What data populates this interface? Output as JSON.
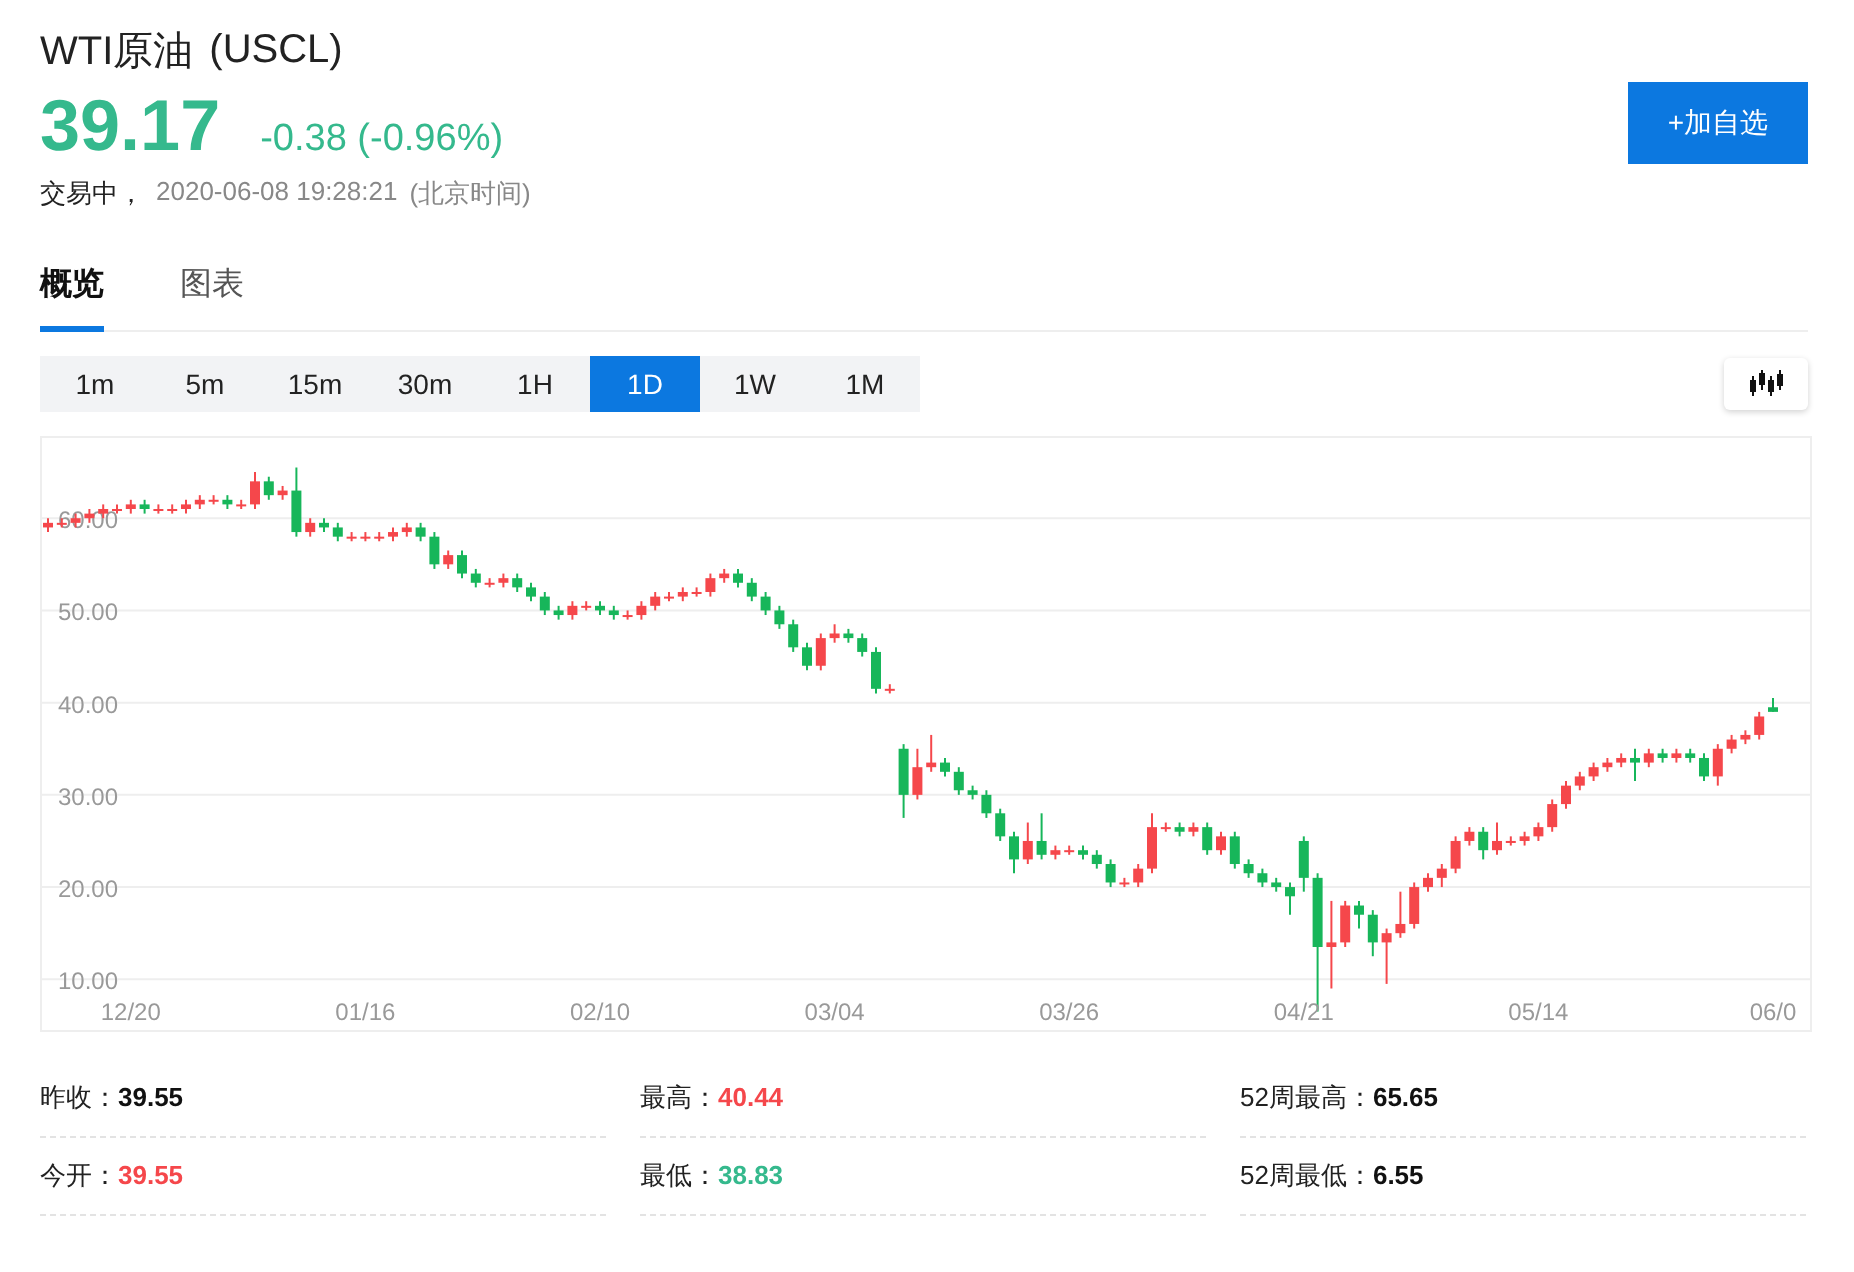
{
  "header": {
    "title": "WTI原油",
    "code": "(USCL)",
    "price": "39.17",
    "change": "-0.38 (-0.96%)",
    "color": "#35b98d",
    "status": "交易中，",
    "timestamp": "2020-06-08 19:28:21",
    "timezone": "(北京时间)",
    "watch_button": "+加自选"
  },
  "tabs": [
    {
      "label": "概览",
      "selected": true
    },
    {
      "label": "图表",
      "selected": false
    }
  ],
  "periods": [
    {
      "label": "1m",
      "selected": false
    },
    {
      "label": "5m",
      "selected": false
    },
    {
      "label": "15m",
      "selected": false
    },
    {
      "label": "30m",
      "selected": false
    },
    {
      "label": "1H",
      "selected": false
    },
    {
      "label": "1D",
      "selected": true
    },
    {
      "label": "1W",
      "selected": false
    },
    {
      "label": "1M",
      "selected": false
    }
  ],
  "chart": {
    "chart_data": {
      "type": "candlestick",
      "ylim": [
        4.5,
        68.7
      ],
      "grid": true,
      "yticks": [
        {
          "value": 60,
          "label": "60.00"
        },
        {
          "value": 50,
          "label": "50.00"
        },
        {
          "value": 40,
          "label": "40.00"
        },
        {
          "value": 30,
          "label": "30.00"
        },
        {
          "value": 20,
          "label": "20.00"
        },
        {
          "value": 10,
          "label": "10.00"
        }
      ],
      "categories": [
        null,
        null,
        null,
        null,
        null,
        null,
        "12/20",
        null,
        null,
        null,
        null,
        null,
        null,
        null,
        null,
        null,
        null,
        null,
        null,
        null,
        null,
        null,
        null,
        "01/16",
        null,
        null,
        null,
        null,
        null,
        null,
        null,
        null,
        null,
        null,
        null,
        null,
        null,
        null,
        null,
        null,
        "02/10",
        null,
        null,
        null,
        null,
        null,
        null,
        null,
        null,
        null,
        null,
        null,
        null,
        null,
        null,
        null,
        null,
        "03/04",
        null,
        null,
        null,
        null,
        null,
        null,
        null,
        null,
        null,
        null,
        null,
        null,
        null,
        null,
        null,
        null,
        "03/26",
        null,
        null,
        null,
        null,
        null,
        null,
        null,
        null,
        null,
        null,
        null,
        null,
        null,
        null,
        null,
        null,
        "04/21",
        null,
        null,
        null,
        null,
        null,
        null,
        null,
        null,
        null,
        null,
        null,
        null,
        null,
        null,
        null,
        null,
        "05/14",
        null,
        null,
        null,
        null,
        null,
        null,
        null,
        null,
        null,
        null,
        null,
        null,
        null,
        null,
        null,
        null,
        "06/0"
      ],
      "ohlc": [
        [
          59,
          60,
          58.5,
          59.5
        ],
        [
          59.5,
          60,
          59,
          59.5
        ],
        [
          59.5,
          60.5,
          59,
          60
        ],
        [
          60,
          61,
          59.5,
          60.5
        ],
        [
          60.5,
          61.5,
          60,
          61
        ],
        [
          61,
          61.5,
          60.5,
          61
        ],
        [
          61,
          62,
          60.5,
          61.5
        ],
        [
          61.5,
          62,
          60.5,
          61
        ],
        [
          61,
          61.5,
          60.5,
          61
        ],
        [
          61,
          61.5,
          60.5,
          61
        ],
        [
          61,
          62,
          60.5,
          61.5
        ],
        [
          61.5,
          62.5,
          61,
          62
        ],
        [
          62,
          62.5,
          61.5,
          62
        ],
        [
          62,
          62.5,
          61,
          61.5
        ],
        [
          61.5,
          62,
          61,
          61.5
        ],
        [
          61.5,
          65,
          61,
          64
        ],
        [
          64,
          64.5,
          62,
          62.5
        ],
        [
          62.5,
          63.5,
          62,
          63
        ],
        [
          63,
          65.5,
          58,
          58.5
        ],
        [
          58.5,
          60,
          58,
          59.5
        ],
        [
          59.5,
          60,
          58.5,
          59
        ],
        [
          59,
          59.5,
          57.5,
          58
        ],
        [
          58,
          58.5,
          57.5,
          58
        ],
        [
          58,
          58.5,
          57.5,
          58
        ],
        [
          58,
          58.5,
          57.5,
          58
        ],
        [
          58,
          59,
          57.5,
          58.5
        ],
        [
          58.5,
          59.5,
          58,
          59
        ],
        [
          59,
          59.5,
          57.5,
          58
        ],
        [
          58,
          58.5,
          54.5,
          55
        ],
        [
          55,
          56.5,
          54.5,
          56
        ],
        [
          56,
          56.5,
          53.5,
          54
        ],
        [
          54,
          54.5,
          52.5,
          53
        ],
        [
          53,
          53.5,
          52.5,
          53
        ],
        [
          53,
          54,
          52.5,
          53.5
        ],
        [
          53.5,
          54,
          52,
          52.5
        ],
        [
          52.5,
          53,
          51,
          51.5
        ],
        [
          51.5,
          52,
          49.5,
          50
        ],
        [
          50,
          50.5,
          49,
          49.5
        ],
        [
          49.5,
          51,
          49,
          50.5
        ],
        [
          50.5,
          51,
          50,
          50.5
        ],
        [
          50.5,
          51,
          49.5,
          50
        ],
        [
          50,
          50.5,
          49,
          49.5
        ],
        [
          49.5,
          50,
          49,
          49.5
        ],
        [
          49.5,
          51,
          49,
          50.5
        ],
        [
          50.5,
          52,
          50,
          51.5
        ],
        [
          51.5,
          52,
          51,
          51.5
        ],
        [
          51.5,
          52.5,
          51,
          52
        ],
        [
          52,
          52.5,
          51.5,
          52
        ],
        [
          52,
          54,
          51.5,
          53.5
        ],
        [
          53.5,
          54.5,
          53,
          54
        ],
        [
          54,
          54.5,
          52.5,
          53
        ],
        [
          53,
          53.5,
          51,
          51.5
        ],
        [
          51.5,
          52,
          49.5,
          50
        ],
        [
          50,
          50.5,
          48,
          48.5
        ],
        [
          48.5,
          49,
          45.5,
          46
        ],
        [
          46,
          46.5,
          43.5,
          44
        ],
        [
          44,
          47.5,
          43.5,
          47
        ],
        [
          47,
          48.5,
          46.5,
          47.5
        ],
        [
          47.5,
          48,
          46.5,
          47
        ],
        [
          47,
          47.5,
          45,
          45.5
        ],
        [
          45.5,
          46,
          41,
          41.5
        ],
        [
          41.5,
          42,
          41,
          41.5
        ],
        [
          35,
          35.5,
          27.5,
          30
        ],
        [
          30,
          35,
          29.5,
          33
        ],
        [
          33,
          36.5,
          32.5,
          33.5
        ],
        [
          33.5,
          34,
          32,
          32.5
        ],
        [
          32.5,
          33,
          30,
          30.5
        ],
        [
          30.5,
          31,
          29.5,
          30
        ],
        [
          30,
          30.5,
          27.5,
          28
        ],
        [
          28,
          28.5,
          25,
          25.5
        ],
        [
          25.5,
          26,
          21.5,
          23
        ],
        [
          23,
          27,
          22.5,
          25
        ],
        [
          25,
          28,
          23,
          23.5
        ],
        [
          23.5,
          24.5,
          23,
          24
        ],
        [
          24,
          24.5,
          23.5,
          24
        ],
        [
          24,
          24.5,
          23,
          23.5
        ],
        [
          23.5,
          24,
          22,
          22.5
        ],
        [
          22.5,
          23,
          20,
          20.5
        ],
        [
          20.5,
          21,
          20,
          20.5
        ],
        [
          20.5,
          22.5,
          20,
          22
        ],
        [
          22,
          28,
          21.5,
          26.5
        ],
        [
          26.5,
          27,
          26,
          26.5
        ],
        [
          26.5,
          27,
          25.5,
          26
        ],
        [
          26,
          27,
          25.5,
          26.5
        ],
        [
          26.5,
          27,
          23.5,
          24
        ],
        [
          24,
          26,
          23.5,
          25.5
        ],
        [
          25.5,
          26,
          22,
          22.5
        ],
        [
          22.5,
          23,
          21,
          21.5
        ],
        [
          21.5,
          22,
          20,
          20.5
        ],
        [
          20.5,
          21,
          19.5,
          20
        ],
        [
          20,
          20.5,
          17,
          19
        ],
        [
          25,
          25.5,
          19.5,
          21
        ],
        [
          21,
          21.5,
          6.5,
          13.5
        ],
        [
          13.5,
          18.5,
          9,
          14
        ],
        [
          14,
          18.5,
          13.5,
          18
        ],
        [
          18,
          18.5,
          15.5,
          17
        ],
        [
          17,
          17.5,
          12.5,
          14
        ],
        [
          14,
          15.5,
          9.5,
          15
        ],
        [
          15,
          19.5,
          14.5,
          16
        ],
        [
          16,
          20.5,
          15.5,
          20
        ],
        [
          20,
          21.5,
          19.5,
          21
        ],
        [
          21,
          22.5,
          20,
          22
        ],
        [
          22,
          25.5,
          21.5,
          25
        ],
        [
          25,
          26.5,
          24.5,
          26
        ],
        [
          26,
          26.5,
          23,
          24
        ],
        [
          24,
          27,
          23.5,
          25
        ],
        [
          25,
          25.5,
          24.5,
          25
        ],
        [
          25,
          26,
          24.5,
          25.5
        ],
        [
          25.5,
          27,
          25,
          26.5
        ],
        [
          26.5,
          29.5,
          26,
          29
        ],
        [
          29,
          31.5,
          28.5,
          31
        ],
        [
          31,
          32.5,
          30.5,
          32
        ],
        [
          32,
          33.5,
          31.5,
          33
        ],
        [
          33,
          34,
          32.5,
          33.5
        ],
        [
          33.5,
          34.5,
          33,
          34
        ],
        [
          34,
          35,
          31.5,
          33.5
        ],
        [
          33.5,
          35,
          33,
          34.5
        ],
        [
          34.5,
          35,
          33.5,
          34
        ],
        [
          34,
          35,
          33.5,
          34.5
        ],
        [
          34.5,
          35,
          33.5,
          34
        ],
        [
          34,
          34.5,
          31.5,
          32
        ],
        [
          32,
          35.5,
          31,
          35
        ],
        [
          35,
          36.5,
          34.5,
          36
        ],
        [
          36,
          37,
          35.5,
          36.5
        ],
        [
          36.5,
          39,
          36,
          38.5
        ],
        [
          39.5,
          40.5,
          39,
          39
        ]
      ]
    }
  },
  "stats": [
    [
      {
        "label": "昨收：",
        "value": "39.55",
        "color": "#111111"
      },
      {
        "label": "最高：",
        "value": "40.44",
        "color": "#f5474b"
      },
      {
        "label": "52周最高：",
        "value": "65.65",
        "color": "#111111"
      }
    ],
    [
      {
        "label": "今开：",
        "value": "39.55",
        "color": "#f5474b"
      },
      {
        "label": "最低：",
        "value": "38.83",
        "color": "#35b98d"
      },
      {
        "label": "52周最低：",
        "value": "6.55",
        "color": "#111111"
      }
    ]
  ]
}
